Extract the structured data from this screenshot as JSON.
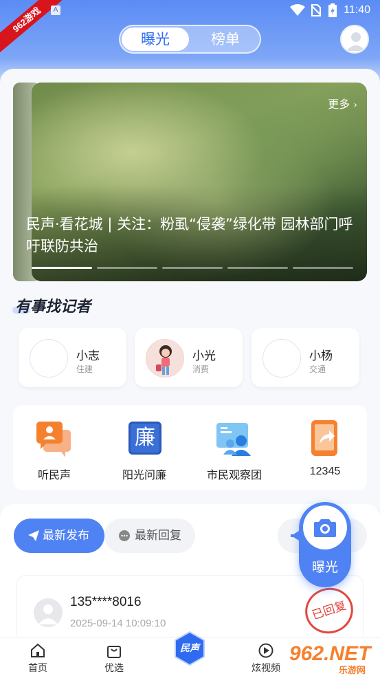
{
  "status_bar": {
    "time": "11:40",
    "corner_badge": "962游戏",
    "app_badge": "A"
  },
  "header": {
    "tabs": [
      {
        "label": "曝光",
        "active": true
      },
      {
        "label": "榜单",
        "active": false
      }
    ],
    "avatar_icon": "user-avatar-icon"
  },
  "banner": {
    "more_label": "更多",
    "title": "民声·看花城 | 关注：粉虱“侵袭”绿化带 园林部门呼吁联防共治",
    "page_count": 5,
    "active_page": 1
  },
  "reporters": {
    "title": "有事找记者",
    "items": [
      {
        "name": "小志",
        "tag": "住建"
      },
      {
        "name": "小光",
        "tag": "消费"
      },
      {
        "name": "小杨",
        "tag": "交通"
      }
    ]
  },
  "services": [
    {
      "label": "听民声",
      "icon": "chat-bubbles-icon"
    },
    {
      "label": "阳光问廉",
      "icon": "lian-seal-icon",
      "icon_text": "廉"
    },
    {
      "label": "市民观察团",
      "icon": "group-id-icon"
    },
    {
      "label": "12345",
      "icon": "phone-share-icon"
    }
  ],
  "feed": {
    "tabs": [
      {
        "label": "最新发布",
        "icon": "paper-plane-icon",
        "active": true
      },
      {
        "label": "最新回复",
        "icon": "chat-dots-icon",
        "active": false
      }
    ],
    "post": {
      "user": "135****8016",
      "time": "2025-09-14 10:09:10",
      "stamp": "已回复"
    }
  },
  "fab": {
    "label": "曝光",
    "icon": "camera-icon"
  },
  "bottom_nav": {
    "items": [
      {
        "label": "首页",
        "icon": "home-icon"
      },
      {
        "label": "优选",
        "icon": "shopping-bag-icon"
      },
      {
        "label": "民声",
        "icon": "minsheng-logo-icon"
      },
      {
        "label": "炫视频",
        "icon": "play-icon"
      }
    ]
  },
  "watermark": {
    "text": "962.NET",
    "subtext": "乐游网"
  },
  "colors": {
    "primary": "#4f82f3",
    "accent_red": "#e2473f",
    "orange": "#f5812f"
  }
}
